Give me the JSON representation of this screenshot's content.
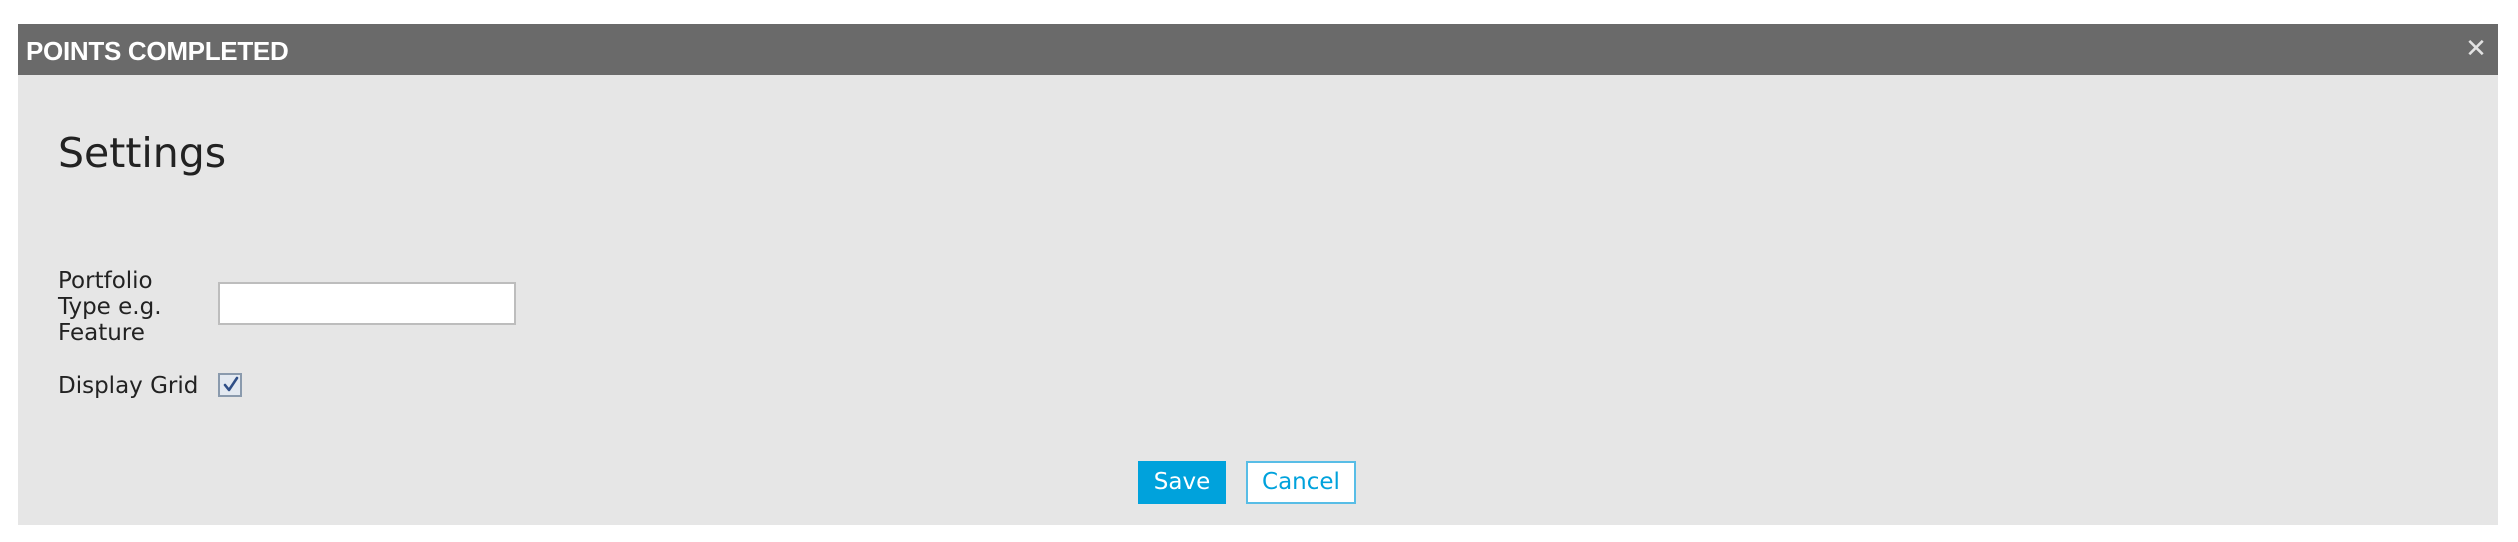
{
  "dialog": {
    "title": "POINTS COMPLETED",
    "close_icon": "close-icon",
    "close_glyph": "✕"
  },
  "settings": {
    "heading": "Settings",
    "portfolio_type_label": "Portfolio Type e.g. Feature",
    "portfolio_type_value": "",
    "portfolio_type_placeholder": "",
    "display_grid_label": "Display Grid",
    "display_grid_checked": true
  },
  "actions": {
    "save_label": "Save",
    "cancel_label": "Cancel"
  },
  "colors": {
    "titlebar": "#6a6a6a",
    "dialog_body": "#e6e6e6",
    "accent": "#00a2dc"
  }
}
